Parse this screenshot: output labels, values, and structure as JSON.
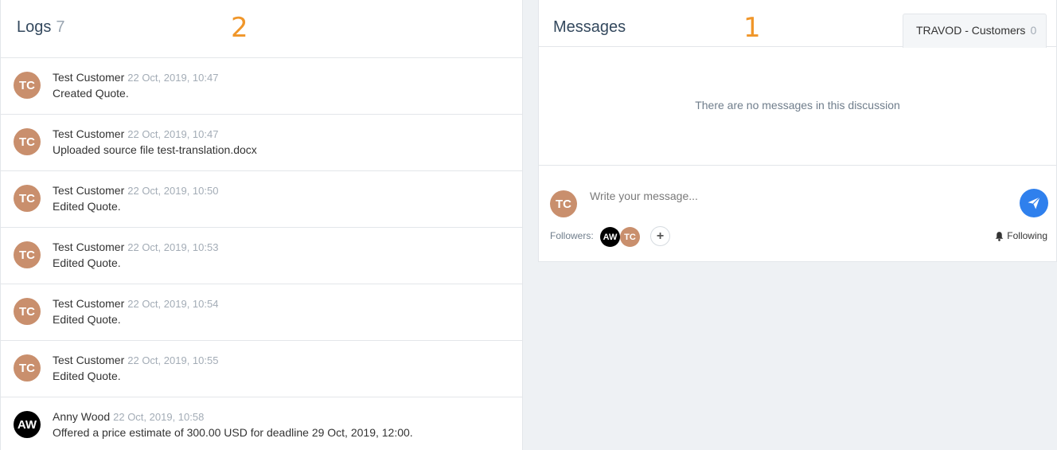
{
  "logs": {
    "title": "Logs",
    "count": "7",
    "marker": "2",
    "items": [
      {
        "initials": "TC",
        "author": "Test Customer",
        "date": "22 Oct, 2019, 10:47",
        "text": "Created Quote."
      },
      {
        "initials": "TC",
        "author": "Test Customer",
        "date": "22 Oct, 2019, 10:47",
        "text": "Uploaded source file test-translation.docx"
      },
      {
        "initials": "TC",
        "author": "Test Customer",
        "date": "22 Oct, 2019, 10:50",
        "text": "Edited Quote."
      },
      {
        "initials": "TC",
        "author": "Test Customer",
        "date": "22 Oct, 2019, 10:53",
        "text": "Edited Quote."
      },
      {
        "initials": "TC",
        "author": "Test Customer",
        "date": "22 Oct, 2019, 10:54",
        "text": "Edited Quote."
      },
      {
        "initials": "TC",
        "author": "Test Customer",
        "date": "22 Oct, 2019, 10:55",
        "text": "Edited Quote."
      },
      {
        "initials": "AW",
        "author": "Anny Wood",
        "date": "22 Oct, 2019, 10:58",
        "text": "Offered a price estimate of 300.00 USD for deadline 29 Oct, 2019, 12:00."
      }
    ]
  },
  "messages": {
    "title": "Messages",
    "marker": "1",
    "tab_label": "TRAVOD - Customers",
    "tab_count": "0",
    "empty_text": "There are no messages in this discussion",
    "composer": {
      "avatar_initials": "TC",
      "placeholder": "Write your message...",
      "followers_label": "Followers:",
      "followers": [
        "AW",
        "TC"
      ],
      "add_follower_glyph": "+",
      "following_label": "Following"
    }
  },
  "colors": {
    "accent": "#2f80ed",
    "marker": "#f0962a",
    "avatar_tc": "#c98f6d",
    "avatar_aw": "#000000"
  },
  "icons": [
    "send-icon",
    "bell-icon",
    "plus-icon"
  ]
}
